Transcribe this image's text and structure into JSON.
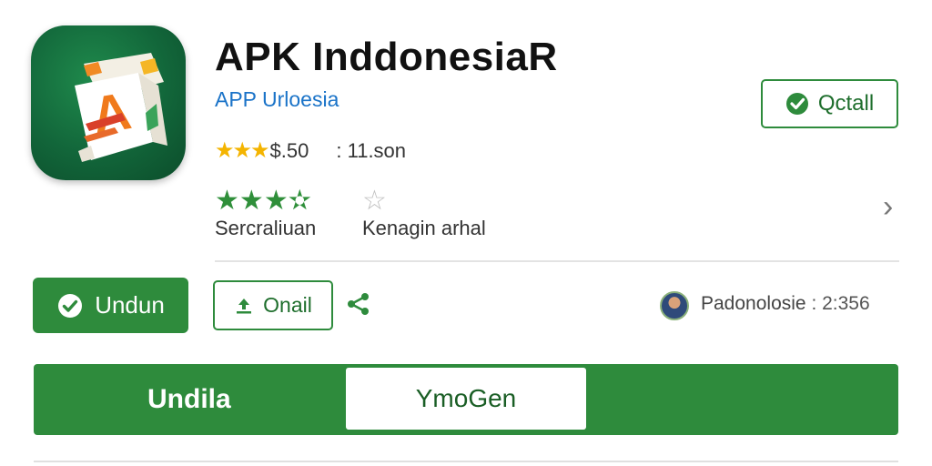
{
  "app": {
    "title": "APK InddonesiaR",
    "developer": "APP Urloesia",
    "price": "$.50",
    "downloads": ": 11.son",
    "icon": "app-logo-icon"
  },
  "header": {
    "install_label": "Qctall"
  },
  "ratings": {
    "left_label": "Sercraliuan",
    "right_label": "Kenagin arhal",
    "colors": {
      "gold": "#f4b400",
      "green": "#2f8f3a",
      "gray": "#bfbfbf"
    }
  },
  "actions": {
    "primary_label": "Undun",
    "secondary_label": "Onail",
    "share_icon": "share-icon"
  },
  "publisher": {
    "name": "Padonolosie",
    "count": ": 2:356"
  },
  "tabs": [
    {
      "label": "Undila"
    },
    {
      "label": "YmoGen"
    }
  ],
  "theme": {
    "accent": "#2e8b3c",
    "link": "#1a73c8"
  }
}
